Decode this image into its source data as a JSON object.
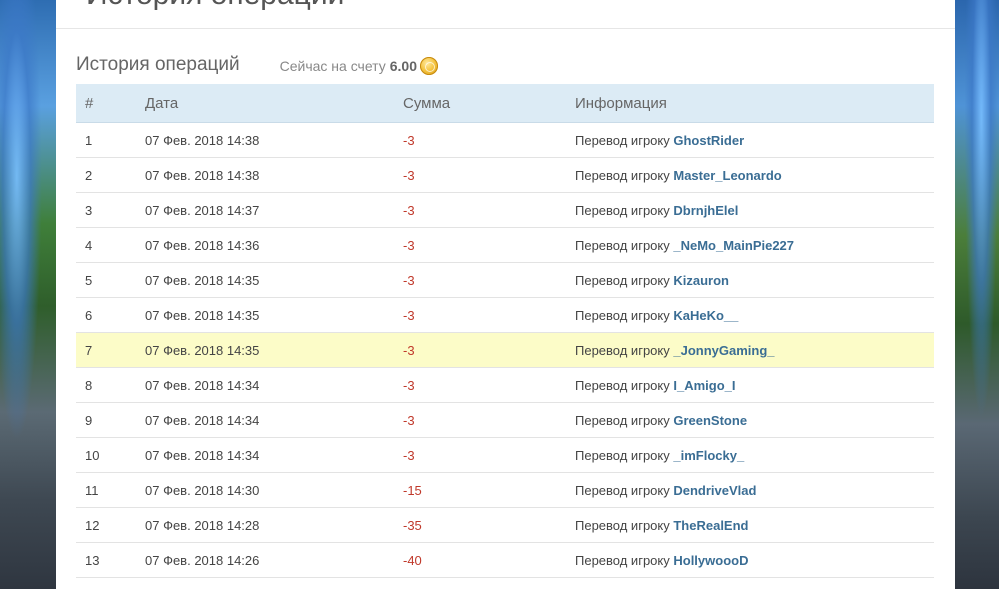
{
  "page_header": {
    "title": "История операций"
  },
  "section": {
    "title": "История операций",
    "balance_label": "Сейчас на счету",
    "balance_value": "6.00"
  },
  "table": {
    "columns": [
      "#",
      "Дата",
      "Сумма",
      "Информация"
    ],
    "info_prefix": "Перевод игроку",
    "rows": [
      {
        "num": "1",
        "date": "07 Фев. 2018 14:38",
        "amount": "-3",
        "player": "GhostRider"
      },
      {
        "num": "2",
        "date": "07 Фев. 2018 14:38",
        "amount": "-3",
        "player": "Master_Leonardo"
      },
      {
        "num": "3",
        "date": "07 Фев. 2018 14:37",
        "amount": "-3",
        "player": "DbrnjhElel"
      },
      {
        "num": "4",
        "date": "07 Фев. 2018 14:36",
        "amount": "-3",
        "player": "_NeMo_MainPie227"
      },
      {
        "num": "5",
        "date": "07 Фев. 2018 14:35",
        "amount": "-3",
        "player": "Kizauron"
      },
      {
        "num": "6",
        "date": "07 Фев. 2018 14:35",
        "amount": "-3",
        "player": "KaHeKo__"
      },
      {
        "num": "7",
        "date": "07 Фев. 2018 14:35",
        "amount": "-3",
        "player": "_JonnyGaming_"
      },
      {
        "num": "8",
        "date": "07 Фев. 2018 14:34",
        "amount": "-3",
        "player": "I_Amigo_I"
      },
      {
        "num": "9",
        "date": "07 Фев. 2018 14:34",
        "amount": "-3",
        "player": "GreenStone"
      },
      {
        "num": "10",
        "date": "07 Фев. 2018 14:34",
        "amount": "-3",
        "player": "_imFlocky_"
      },
      {
        "num": "11",
        "date": "07 Фев. 2018 14:30",
        "amount": "-15",
        "player": "DendriveVlad"
      },
      {
        "num": "12",
        "date": "07 Фев. 2018 14:28",
        "amount": "-35",
        "player": "TheRealEnd"
      },
      {
        "num": "13",
        "date": "07 Фев. 2018 14:26",
        "amount": "-40",
        "player": "HollywoooD"
      }
    ]
  },
  "colors": {
    "header_bg": "#dcebf5",
    "highlight_row": "#fcfcc8",
    "negative_amount": "#c0392b",
    "player_link": "#3a6d94"
  }
}
